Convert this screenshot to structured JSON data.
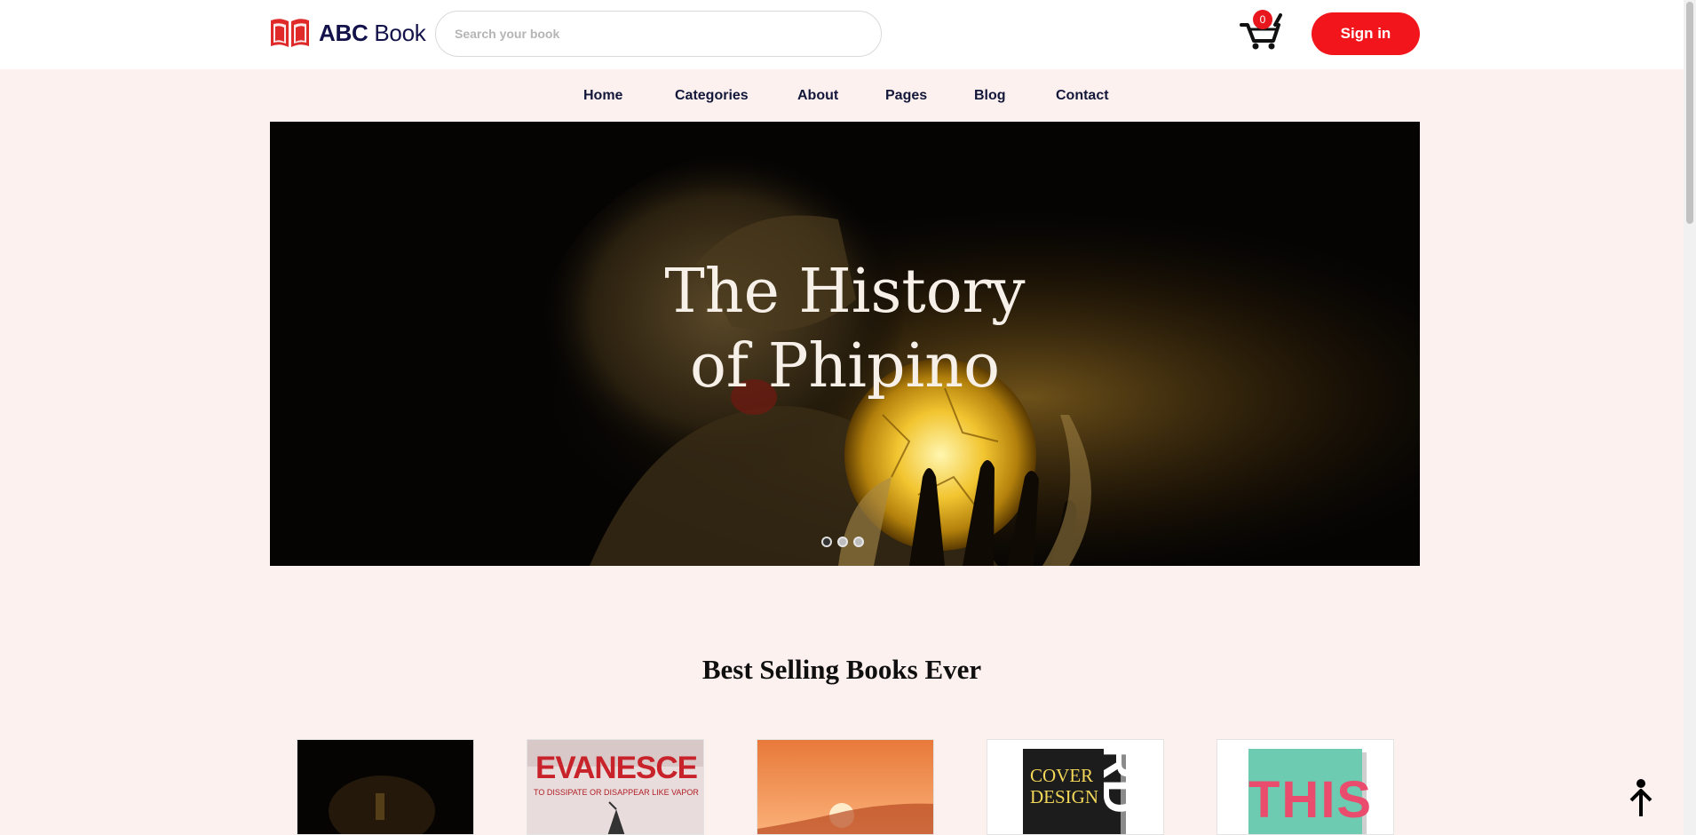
{
  "header": {
    "logo_bold": "ABC",
    "logo_light": "Book",
    "search_placeholder": "Search your book",
    "cart_count": "0",
    "signin_label": "Sign in"
  },
  "nav": {
    "items": [
      "Home",
      "Categories",
      "About",
      "Pages",
      "Blog",
      "Contact"
    ]
  },
  "hero": {
    "title_line1": "The History",
    "title_line2": "of Phipino",
    "slide_count": 3,
    "active_slide": 1
  },
  "section": {
    "title": "Best Selling Books Ever"
  },
  "books": [
    {
      "cover_text": ""
    },
    {
      "cover_text": "EVANESCE",
      "cover_subtext": "TO DISSIPATE OR DISAPPEAR LIKE VAPOR"
    },
    {
      "cover_text": ""
    },
    {
      "cover_text": "COVER DESIGN",
      "cover_side_text": "RD"
    },
    {
      "cover_text": "THIS"
    }
  ],
  "colors": {
    "accent": "#f2161c",
    "brand_navy": "#13124a",
    "page_bg": "#fdf1f0"
  }
}
